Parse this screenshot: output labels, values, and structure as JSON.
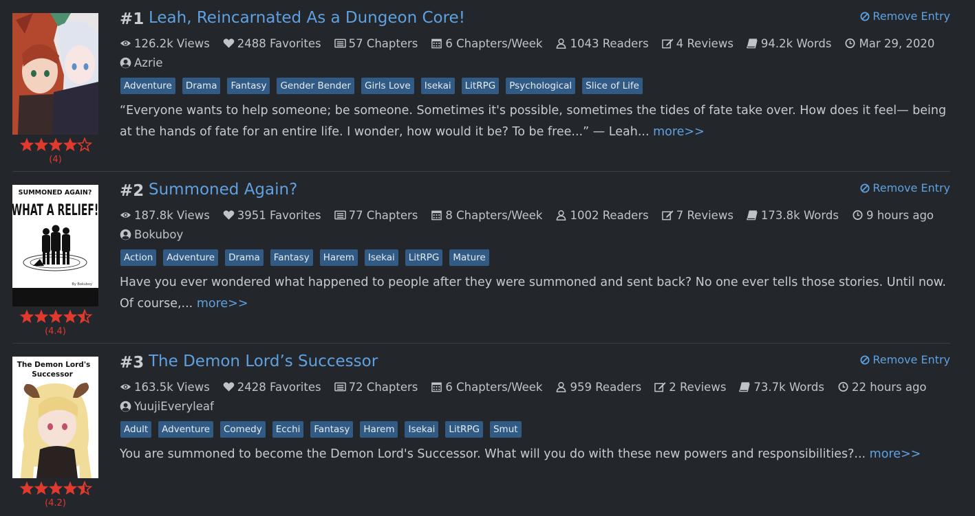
{
  "colors": {
    "background": "#23272c",
    "link": "#5fa1e0",
    "tag_bg": "#315a85",
    "star": "#e2392f"
  },
  "entries": [
    {
      "rank": "#1",
      "title": "Leah, Reincarnated As a Dungeon Core!",
      "remove_label": "Remove Entry",
      "stats": {
        "views": "126.2k Views",
        "favorites": "2488 Favorites",
        "chapters": "57 Chapters",
        "chapters_per_week": "6 Chapters/Week",
        "readers": "1043 Readers",
        "reviews": "4 Reviews",
        "words": "94.2k Words",
        "updated": "Mar 29, 2020"
      },
      "author": "Azrie",
      "tags": [
        "Adventure",
        "Drama",
        "Fantasy",
        "Gender Bender",
        "Girls Love",
        "Isekai",
        "LitRPG",
        "Psychological",
        "Slice of Life"
      ],
      "description": "“Everyone wants to help someone; be someone. Sometimes it's possible, sometimes the tides of fate take over. How does it feel— being at the hands of fate for an entire life. I wonder, how would it be? To be free...” — Leah...",
      "more_label": "more>>",
      "rating_value": 4,
      "rating_label": "(4)"
    },
    {
      "rank": "#2",
      "title": "Summoned Again?",
      "remove_label": "Remove Entry",
      "stats": {
        "views": "187.8k Views",
        "favorites": "3951 Favorites",
        "chapters": "77 Chapters",
        "chapters_per_week": "8 Chapters/Week",
        "readers": "1002 Readers",
        "reviews": "7 Reviews",
        "words": "173.8k Words",
        "updated": "9 hours ago"
      },
      "author": "Bokuboy",
      "tags": [
        "Action",
        "Adventure",
        "Drama",
        "Fantasy",
        "Harem",
        "Isekai",
        "LitRPG",
        "Mature"
      ],
      "description": "Have you ever wondered what happened to people after they were summoned and sent back? No one ever tells those stories. Until now. Of course,...",
      "more_label": "more>>",
      "rating_value": 4.4,
      "rating_label": "(4.4)",
      "cover_text": {
        "line1": "SUMMONED AGAIN?",
        "line2": "WHAT A RELIEF!",
        "byline": "By Bokuboy"
      }
    },
    {
      "rank": "#3",
      "title": "The Demon Lord’s Successor",
      "remove_label": "Remove Entry",
      "stats": {
        "views": "163.5k Views",
        "favorites": "2428 Favorites",
        "chapters": "72 Chapters",
        "chapters_per_week": "6 Chapters/Week",
        "readers": "959 Readers",
        "reviews": "2 Reviews",
        "words": "73.7k Words",
        "updated": "22 hours ago"
      },
      "author": "YuujiEveryleaf",
      "tags": [
        "Adult",
        "Adventure",
        "Comedy",
        "Ecchi",
        "Fantasy",
        "Harem",
        "Isekai",
        "LitRPG",
        "Smut"
      ],
      "description": "You are summoned to become the Demon Lord's Successor. What will you do with these new powers and responsibilities?...",
      "more_label": "more>>",
      "rating_value": 4.2,
      "rating_label": "(4.2)",
      "cover_text": {
        "line1": "The Demon Lord's",
        "line2": "Successor"
      }
    }
  ]
}
